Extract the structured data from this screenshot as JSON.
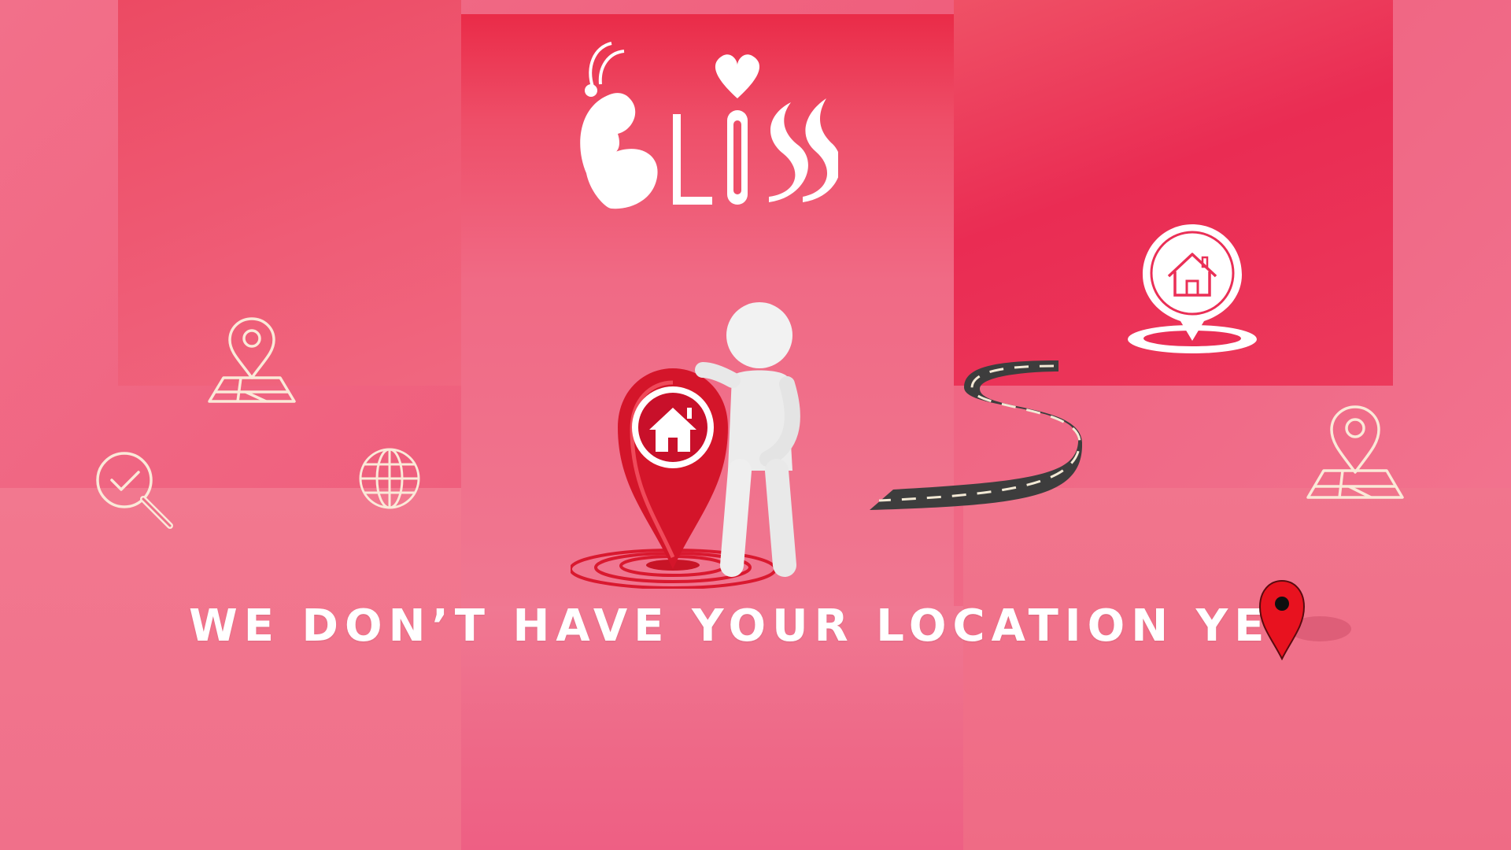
{
  "brand": {
    "logo_text": "BLISS"
  },
  "headline": {
    "text": "WE DON’T HAVE YOUR LOCATION YET"
  },
  "icons": {
    "map_pin_left": "map-pin-icon",
    "search_check": "search-check-icon",
    "globe": "globe-icon",
    "home_pin": "home-location-icon",
    "map_pin_right": "map-pin-icon",
    "road": "road-icon",
    "red_pin": "red-location-pin-icon"
  },
  "colors": {
    "accent": "#e8203f",
    "icon_line": "#fbe9d8",
    "text": "#ffffff"
  }
}
